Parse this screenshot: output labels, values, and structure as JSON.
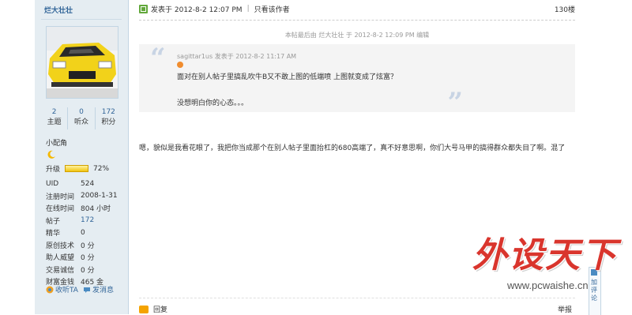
{
  "profile": {
    "username": "烂大壮壮",
    "stats": [
      {
        "value": "2",
        "label": "主题"
      },
      {
        "value": "0",
        "label": "听众"
      },
      {
        "value": "172",
        "label": "积分"
      }
    ],
    "rank": "小配角",
    "upgrade_label": "升级",
    "upgrade_percent": "72%",
    "upgrade_progress": 0.72,
    "info": [
      {
        "key": "UID",
        "value": "524"
      },
      {
        "key": "注册时间",
        "value": "2008-1-31"
      },
      {
        "key": "在线时间",
        "value": "804 小时"
      },
      {
        "key": "帖子",
        "value": "172"
      },
      {
        "key": "精华",
        "value": "0"
      },
      {
        "key": "原创技术",
        "value": "0 分"
      },
      {
        "key": "助人威望",
        "value": "0 分"
      },
      {
        "key": "交易诚信",
        "value": "0 分"
      },
      {
        "key": "财富金钱",
        "value": "465 金"
      }
    ],
    "follow_label": "收听TA",
    "message_label": "发消息"
  },
  "post": {
    "posted_at": "发表于 2012-8-2 12:07 PM",
    "only_author": "只看该作者",
    "floor": "130楼",
    "edit_note": "本帖最后由 烂大壮壮 于 2012-8-2 12:09 PM 编辑",
    "quote": {
      "meta": "sagittar1us 发表于 2012-8-2 11:17 AM",
      "line1": "面对在别人帖子里搞乱吹牛B又不敢上图的低端喷 上图就变成了炫富？",
      "line2": "没想明白你的心态。。。"
    },
    "body": "嗯，貌似是我看花眼了，我把你当成那个在别人帖子里面抬杠的680高端了，真不好意思啊，你们大号马甲的搞得群众都失目了啊。混了",
    "reply_label": "回复",
    "report_label": "举报"
  },
  "float_tab": {
    "label": "加评论"
  },
  "watermark": {
    "main": "外设天下",
    "sub": "www.pcwaishe.cn"
  },
  "colors": {
    "link": "#336699",
    "panel": "#e5edf2",
    "watermark": "#d9352d"
  }
}
